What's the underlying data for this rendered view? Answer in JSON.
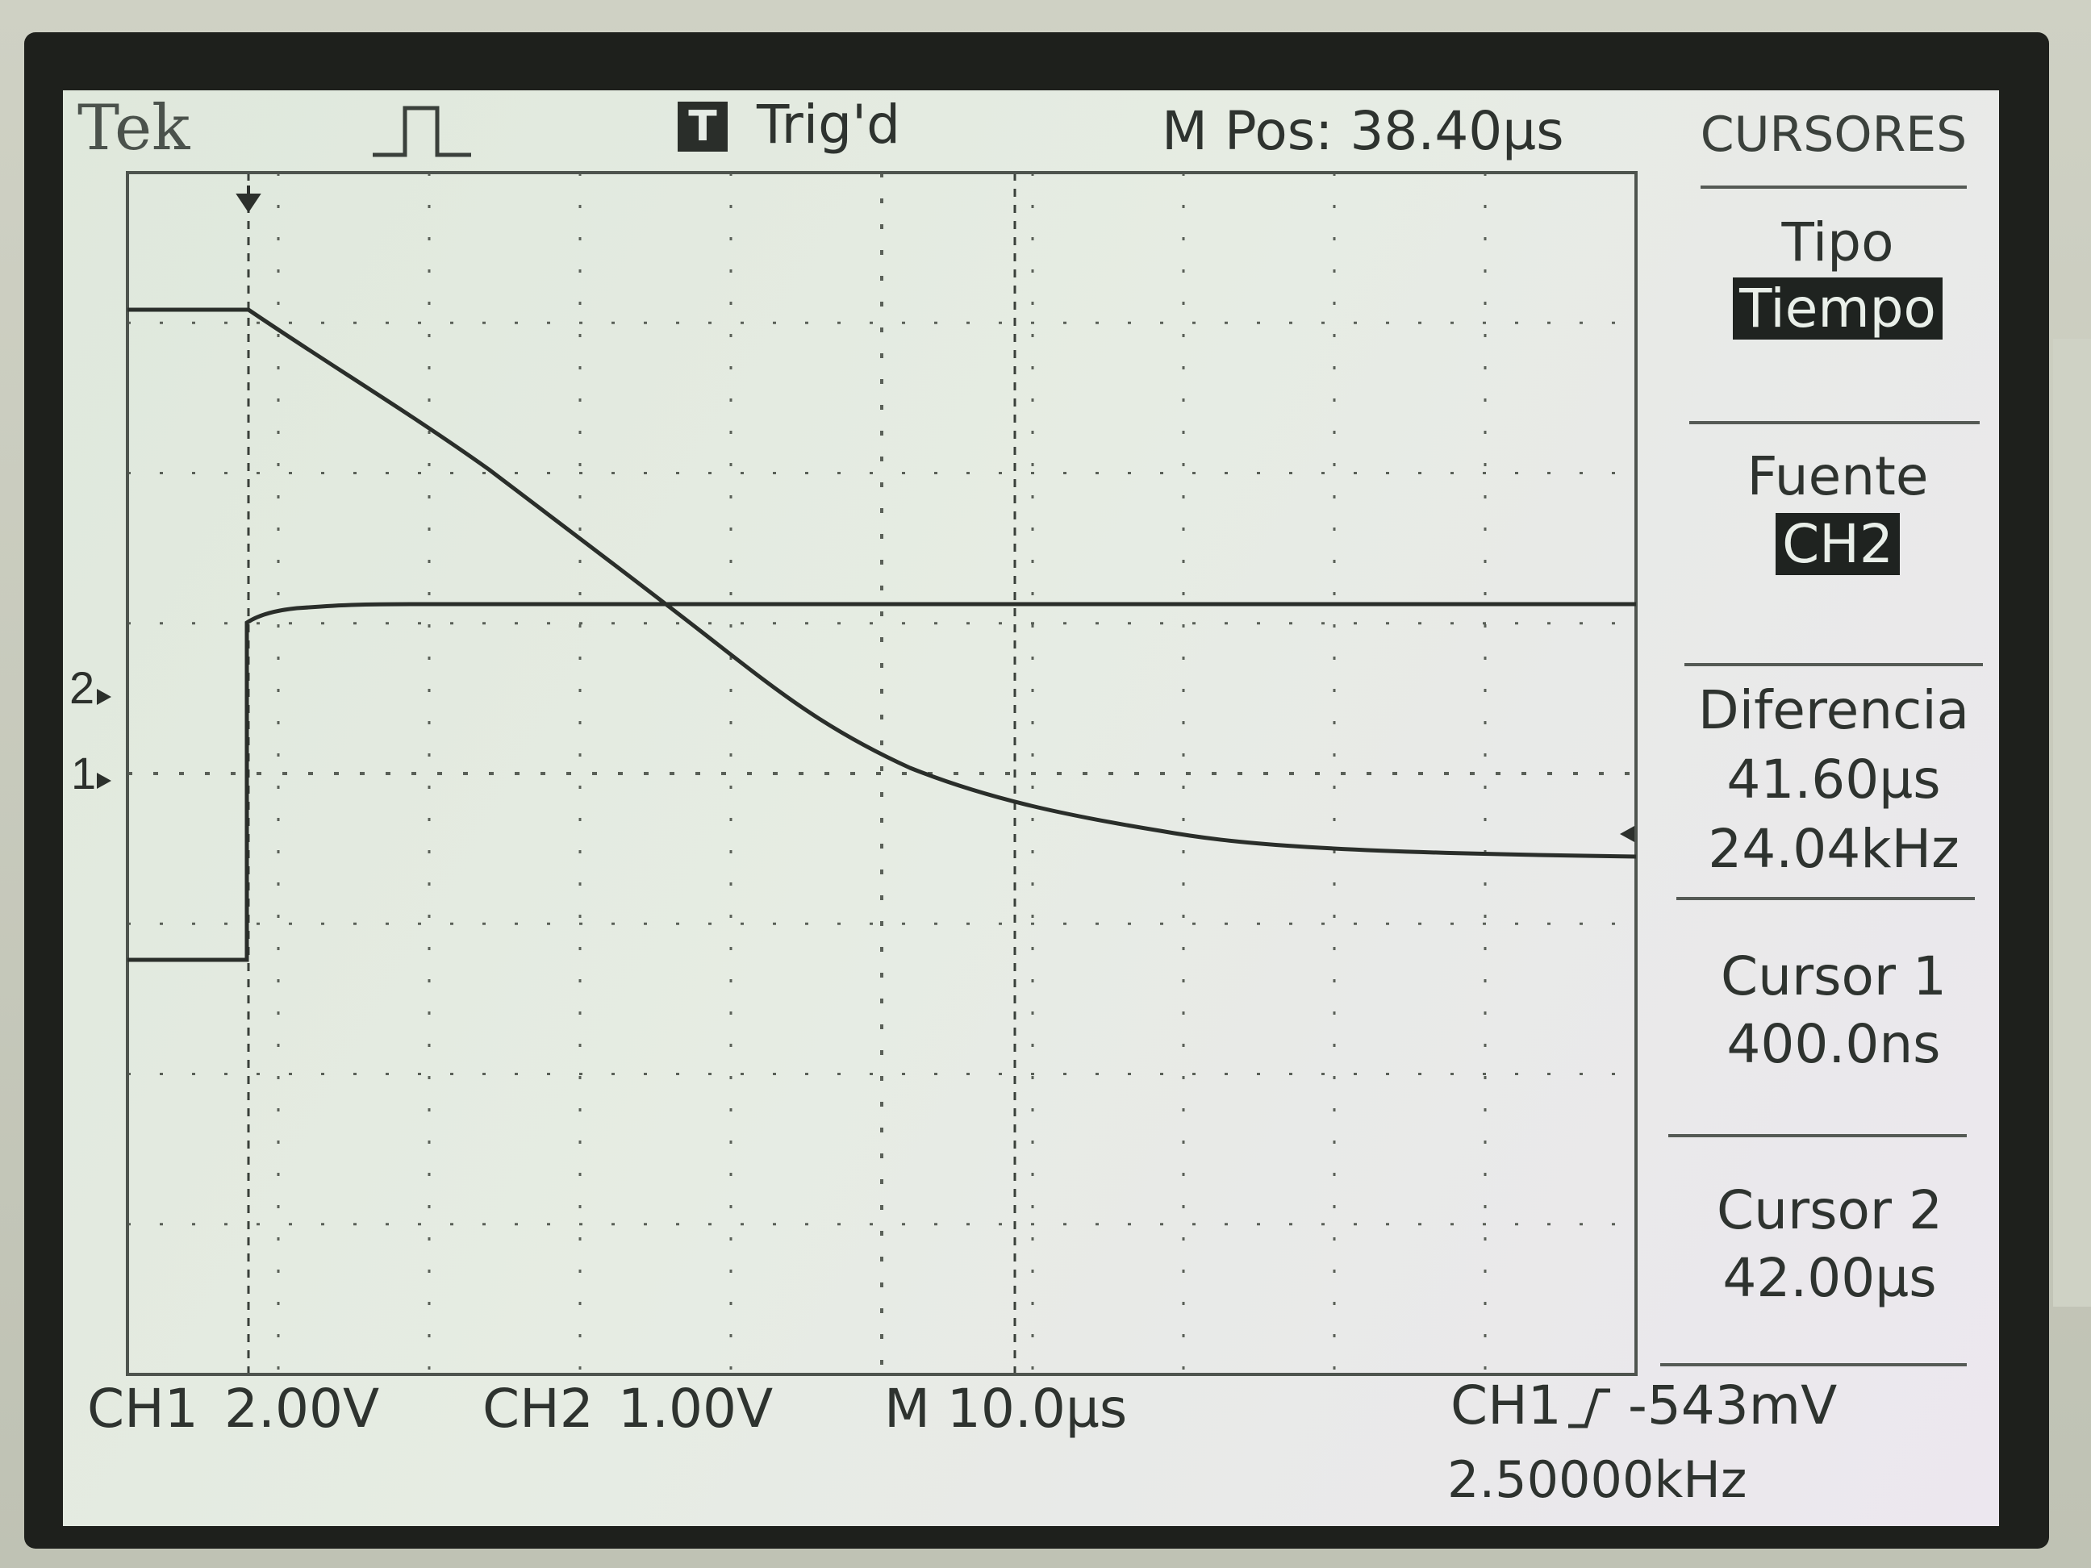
{
  "header": {
    "brand": "Tek",
    "trigger_status": "Trig'd",
    "mpos": "M Pos: 38.40µs",
    "trigger_icon": "trigger-square-icon",
    "acquire_icon": "pulse-shape-icon"
  },
  "menu": {
    "title": "CURSORES",
    "tipo": {
      "label": "Tipo",
      "value": "Tiempo"
    },
    "fuente": {
      "label": "Fuente",
      "value": "CH2"
    },
    "diferencia": {
      "label": "Diferencia",
      "delta": "41.60µs",
      "freq": "24.04kHz"
    },
    "cursor1": {
      "label": "Cursor 1",
      "value": "400.0ns"
    },
    "cursor2": {
      "label": "Cursor 2",
      "value": "42.00µs"
    }
  },
  "footer": {
    "ch1_label": "CH1",
    "ch1_scale": "2.00V",
    "ch2_label": "CH2",
    "ch2_scale": "1.00V",
    "timebase": "M 10.0µs",
    "trigger_source": "CH1",
    "trigger_slope_icon": "rising-edge-icon",
    "trigger_level": "-543mV",
    "trigger_freq": "2.50000kHz"
  },
  "markers": {
    "ch2": "2",
    "ch1": "1"
  },
  "colors": {
    "trace": "#2c302c",
    "grid": "#5a6058",
    "screen": "#e3eae0"
  }
}
